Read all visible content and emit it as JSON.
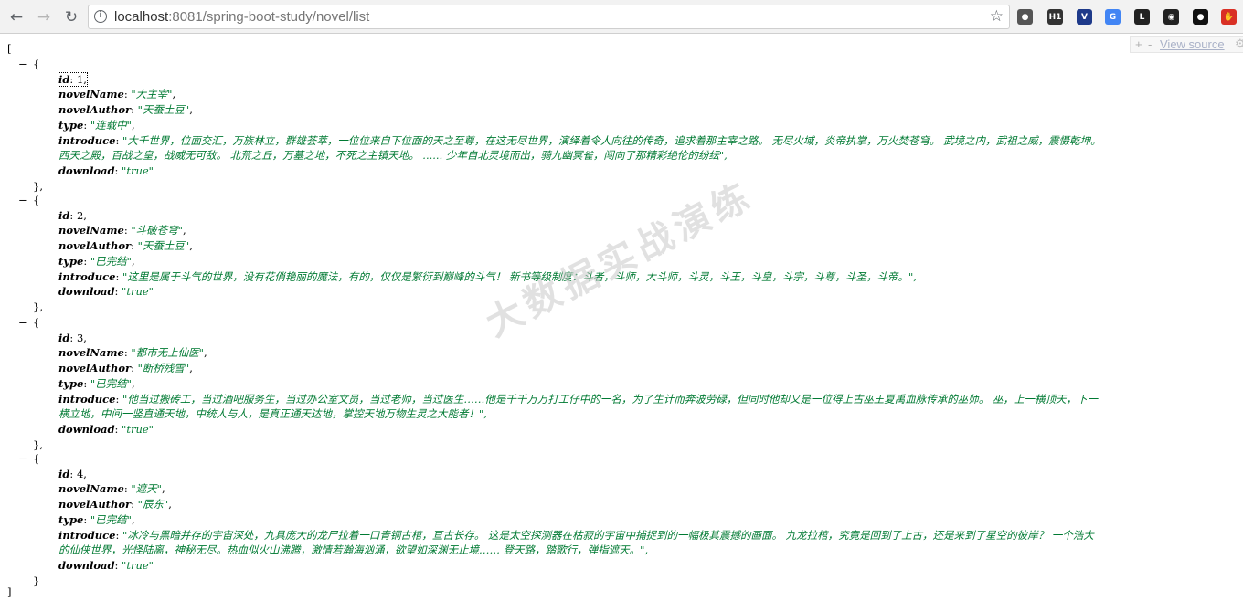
{
  "browser": {
    "url_host": "localhost",
    "url_rest": ":8081/spring-boot-study/novel/list",
    "back_label": "←",
    "forward_label": "→",
    "reload_label": "↻",
    "star_label": "☆",
    "extensions": [
      {
        "name": "github-extension-icon",
        "glyph": "●",
        "color": "#555555"
      },
      {
        "name": "h1-extension-icon",
        "glyph": "H1",
        "color": "#333333"
      },
      {
        "name": "vue-devtools-icon",
        "glyph": "V",
        "color": "#1e3a8a"
      },
      {
        "name": "google-translate-icon",
        "glyph": "G",
        "color": "#4285f4"
      },
      {
        "name": "lastpass-icon",
        "glyph": "L",
        "color": "#222222"
      },
      {
        "name": "color-picker-icon",
        "glyph": "◉",
        "color": "#222222"
      },
      {
        "name": "dark-mode-icon",
        "glyph": "●",
        "color": "#111111"
      },
      {
        "name": "stop-icon",
        "glyph": "✋",
        "color": "#d93025"
      }
    ],
    "view_source": {
      "plus": "+",
      "minus": "-",
      "label": "View source",
      "gear": "⚙"
    }
  },
  "json": {
    "open_bracket": "[",
    "close_bracket": "]",
    "keys": {
      "id": "id",
      "novelName": "novelName",
      "novelAuthor": "novelAuthor",
      "type": "type",
      "introduce": "introduce",
      "download": "download"
    },
    "items": [
      {
        "id": "1",
        "novelName": "\"大主宰\"",
        "novelAuthor": "\"天蚕土豆\"",
        "type": "\"连载中\"",
        "introduce_lines": [
          "\"大千世界，位面交汇，万族林立，群雄荟萃，一位位来自下位面的天之至尊，在这无尽世界，演绎着令人向往的传奇，追求着那主宰之路。  无尽火域，炎帝执掌，万火焚苍穹。  武境之内，武祖之威，震慑乾坤。",
          "西天之殿，百战之皇，战威无可敌。  北荒之丘，万墓之地，不死之主镇天地。  ......  少年自北灵境而出，骑九幽冥雀，闯向了那精彩绝伦的纷纭\","
        ],
        "download": "\"true\""
      },
      {
        "id": "2",
        "novelName": "\"斗破苍穹\"",
        "novelAuthor": "\"天蚕土豆\"",
        "type": "\"已完结\"",
        "introduce_lines": [
          "\"这里是属于斗气的世界，没有花俏艳丽的魔法，有的，仅仅是繁衍到巅峰的斗气！  新书等级制度：斗者，斗师，大斗师，斗灵，斗王，斗皇，斗宗，斗尊，斗圣，斗帝。\","
        ],
        "download": "\"true\""
      },
      {
        "id": "3",
        "novelName": "\"都市无上仙医\"",
        "novelAuthor": "\"断桥残雪\"",
        "type": "\"已完结\"",
        "introduce_lines": [
          "\"他当过搬砖工，当过酒吧服务生，当过办公室文员，当过老师，当过医生……他是千千万万打工仔中的一名，为了生计而奔波劳碌，但同时他却又是一位得上古巫王夏禹血脉传承的巫师。  巫，上一横顶天，下一",
          "横立地，中间一竖直通天地，中统人与人，是真正通天达地，掌控天地万物生灵之大能者！\","
        ],
        "download": "\"true\""
      },
      {
        "id": "4",
        "novelName": "\"遮天\"",
        "novelAuthor": "\"辰东\"",
        "type": "\"已完结\"",
        "introduce_lines": [
          "\"冰冷与黑暗并存的宇宙深处，九具庞大的龙尸拉着一口青铜古棺，亘古长存。  这是太空探测器在枯寂的宇宙中捕捉到的一幅极其震撼的画面。  九龙拉棺，究竟是回到了上古，还是来到了星空的彼岸？  一个浩大",
          "的仙侠世界，光怪陆离，神秘无尽。热血似火山沸腾，激情若瀚海汹涌，欲望如深渊无止境……  登天路，踏歌行，弹指遮天。\","
        ],
        "download": "\"true\""
      }
    ]
  },
  "watermark": "大数据实战演练"
}
